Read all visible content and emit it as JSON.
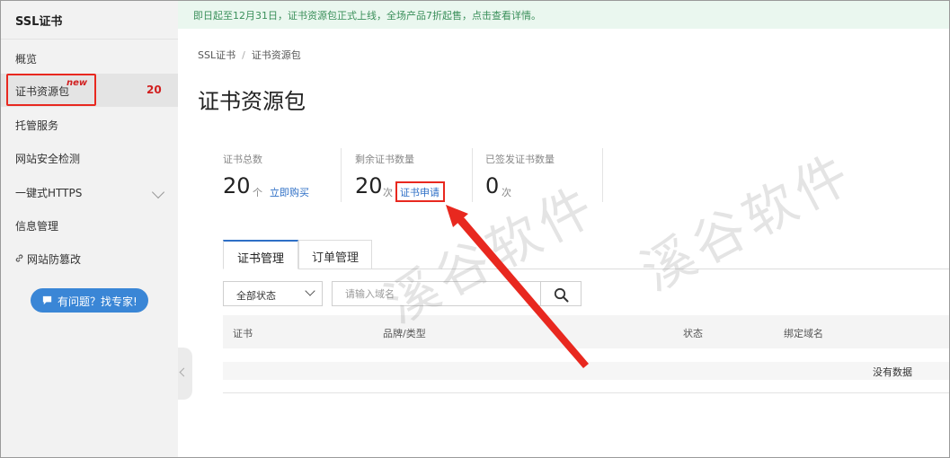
{
  "sidebar": {
    "title": "SSL证书",
    "items": [
      {
        "label": "概览"
      },
      {
        "label": "证书资源包",
        "badge": "new",
        "count": "20"
      },
      {
        "label": "托管服务"
      },
      {
        "label": "网站安全检测"
      },
      {
        "label": "一键式HTTPS"
      },
      {
        "label": "信息管理"
      },
      {
        "label": "网站防篡改"
      }
    ],
    "help_button": "有问题？找专家!"
  },
  "notice": "即日起至12月31日，证书资源包正式上线，全场产品7折起售，点击查看详情。",
  "breadcrumb": {
    "root": "SSL证书",
    "separator": "/",
    "current": "证书资源包"
  },
  "page_title": "证书资源包",
  "stats": {
    "total": {
      "label": "证书总数",
      "value": "20",
      "unit": "个",
      "link": "立即购买"
    },
    "remaining": {
      "label": "剩余证书数量",
      "value": "20",
      "unit": "次",
      "link": "证书申请"
    },
    "issued": {
      "label": "已签发证书数量",
      "value": "0",
      "unit": "次"
    }
  },
  "tabs": [
    {
      "label": "证书管理",
      "active": true
    },
    {
      "label": "订单管理",
      "active": false
    }
  ],
  "filter": {
    "status_selected": "全部状态",
    "search_placeholder": "请输入域名"
  },
  "table": {
    "columns": [
      "证书",
      "品牌/类型",
      "状态",
      "绑定域名"
    ],
    "empty_text": "没有数据"
  },
  "watermark": "溪谷软件",
  "colors": {
    "accent": "#2e6fc6",
    "highlight": "#e8281f",
    "notice_bg": "#eaf7ef",
    "notice_text": "#3a8f5a",
    "help_button": "#3a86d6"
  },
  "icons": {
    "search": "search-icon",
    "chevron": "chevron-down-icon",
    "link": "link-icon",
    "help": "chat-bubble-icon",
    "collapse": "chevron-left-icon"
  }
}
